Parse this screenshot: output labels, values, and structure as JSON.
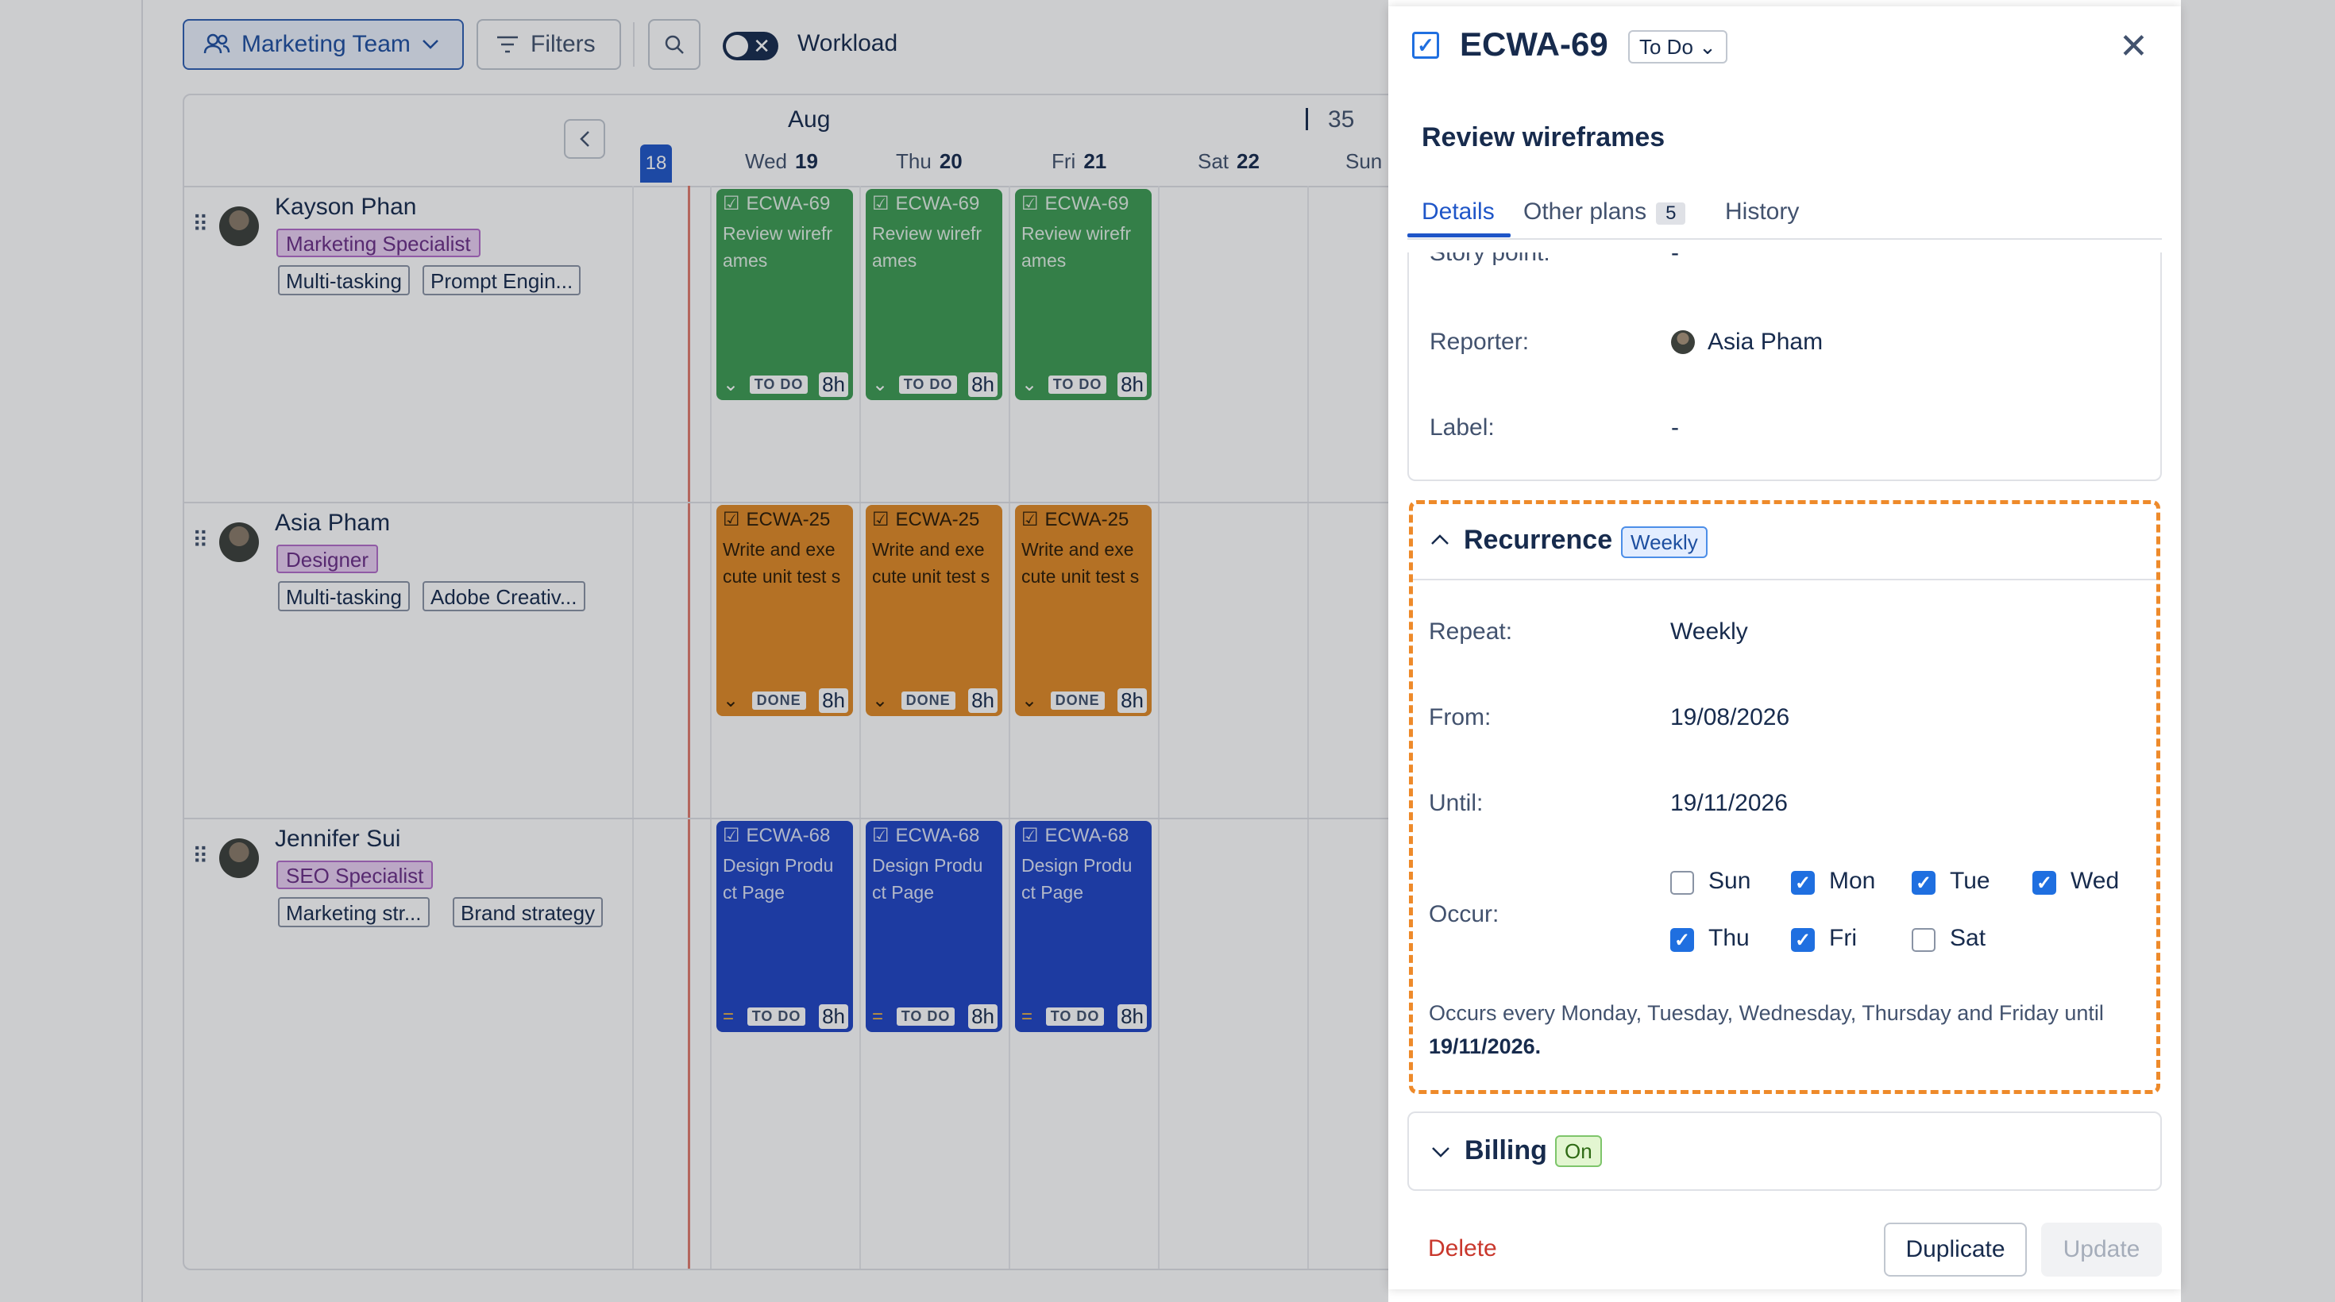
{
  "toolbar": {
    "team_label": "Marketing Team",
    "filters_label": "Filters",
    "workload_label": "Workload"
  },
  "calendar": {
    "month": "Aug",
    "week_number": "35",
    "today": "18",
    "days": [
      {
        "name": "Wed",
        "num": "19"
      },
      {
        "name": "Thu",
        "num": "20"
      },
      {
        "name": "Fri",
        "num": "21"
      },
      {
        "name": "Sat",
        "num": "22"
      },
      {
        "name": "Sun",
        "num": ""
      }
    ]
  },
  "people": [
    {
      "name": "Kayson Phan",
      "role": "Marketing Specialist",
      "skills": [
        "Multi-tasking",
        "Prompt Engin..."
      ],
      "task": {
        "key": "ECWA-69",
        "title": "Review wirefr ames",
        "status": "TO DO",
        "hours": "8h",
        "color": "#3d9b52"
      }
    },
    {
      "name": "Asia Pham",
      "role": "Designer",
      "skills": [
        "Multi-tasking",
        "Adobe Creativ..."
      ],
      "task": {
        "key": "ECWA-25",
        "title": "Write and exe cute unit test s",
        "status": "DONE",
        "hours": "8h",
        "color": "#e08a26"
      }
    },
    {
      "name": "Jennifer Sui",
      "role": "SEO Specialist",
      "skills": [
        "Marketing str...",
        "Brand strategy"
      ],
      "task": {
        "key": "ECWA-68",
        "title": "Design Produ ct Page",
        "status": "TO DO",
        "hours": "8h",
        "color": "#1f45c4"
      }
    }
  ],
  "panel": {
    "issue_key": "ECWA-69",
    "status": "To Do",
    "title": "Review wireframes",
    "tabs": {
      "details": "Details",
      "other_plans": "Other plans",
      "other_plans_count": "5",
      "history": "History"
    },
    "fields": {
      "story_point_label": "Story point:",
      "story_point_value": "-",
      "reporter_label": "Reporter:",
      "reporter_value": "Asia Pham",
      "label_label": "Label:",
      "label_value": "-"
    },
    "recurrence": {
      "title": "Recurrence",
      "badge": "Weekly",
      "repeat_label": "Repeat:",
      "repeat_value": "Weekly",
      "from_label": "From:",
      "from_value": "19/08/2026",
      "until_label": "Until:",
      "until_value": "19/11/2026",
      "occur_label": "Occur:",
      "days": {
        "sun": "Sun",
        "mon": "Mon",
        "tue": "Tue",
        "wed": "Wed",
        "thu": "Thu",
        "fri": "Fri",
        "sat": "Sat"
      },
      "summary_text": "Occurs every Monday, Tuesday, Wednesday, Thursday and Friday until",
      "summary_date": "19/11/2026."
    },
    "billing": {
      "title": "Billing",
      "badge": "On"
    },
    "actions": {
      "delete": "Delete",
      "duplicate": "Duplicate",
      "update": "Update"
    }
  }
}
